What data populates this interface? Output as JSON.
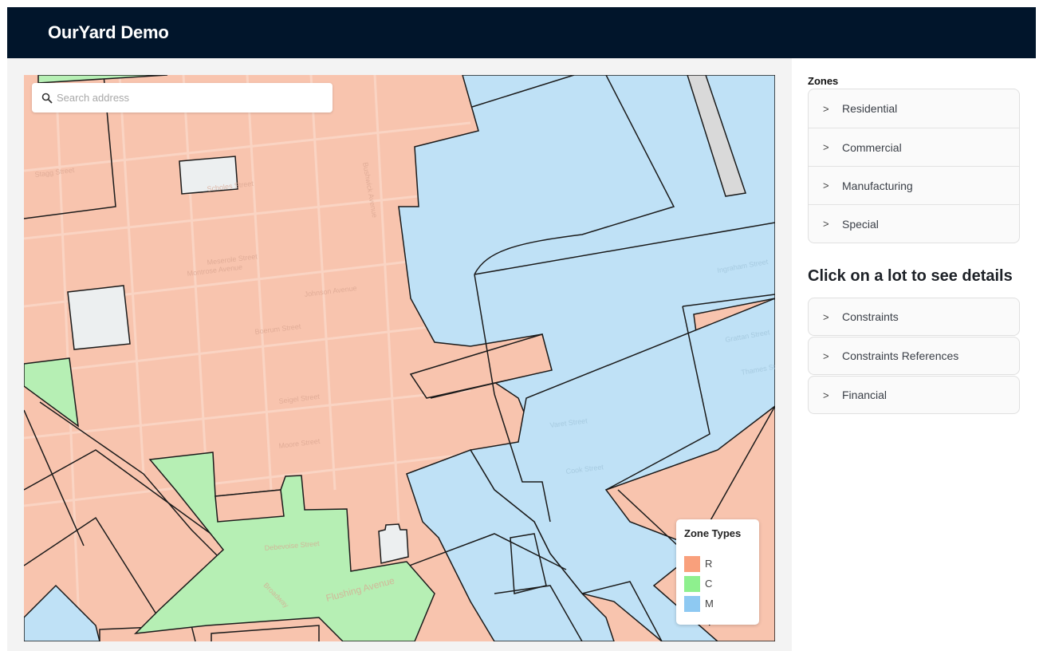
{
  "header": {
    "title": "OurYard Demo"
  },
  "map": {
    "search": {
      "placeholder": "Search address",
      "value": ""
    },
    "legend": {
      "title": "Zone Types",
      "items": [
        {
          "label": "R",
          "color": "#f9a07c"
        },
        {
          "label": "C",
          "color": "#8ef08e"
        },
        {
          "label": "M",
          "color": "#8ec9f2"
        }
      ]
    },
    "zone_fills": {
      "R": "#f8c4ae",
      "C": "#b6efb4",
      "M": "#bfe1f6",
      "special": "#d9d9d9",
      "unzoned": "#eceff0"
    },
    "street_labels": [
      "Bushwick Avenue",
      "Broadway",
      "Flushing Avenue",
      "Montrose Avenue",
      "Johnson Avenue",
      "Meserole Street",
      "Scholes Street",
      "Stagg Street",
      "Boerum Street",
      "Seigel Street",
      "Moore Street",
      "Varet Street",
      "Cook Street",
      "Debevoise Street",
      "Ingraham Street",
      "Grattan Street",
      "Thames Street"
    ]
  },
  "sidebar": {
    "zones_title": "Zones",
    "zones": [
      {
        "label": "Residential"
      },
      {
        "label": "Commercial"
      },
      {
        "label": "Manufacturing"
      },
      {
        "label": "Special"
      }
    ],
    "details_title": "Click on a lot to see details",
    "details": [
      {
        "label": "Constraints"
      },
      {
        "label": "Constraints References"
      },
      {
        "label": "Financial"
      }
    ]
  }
}
